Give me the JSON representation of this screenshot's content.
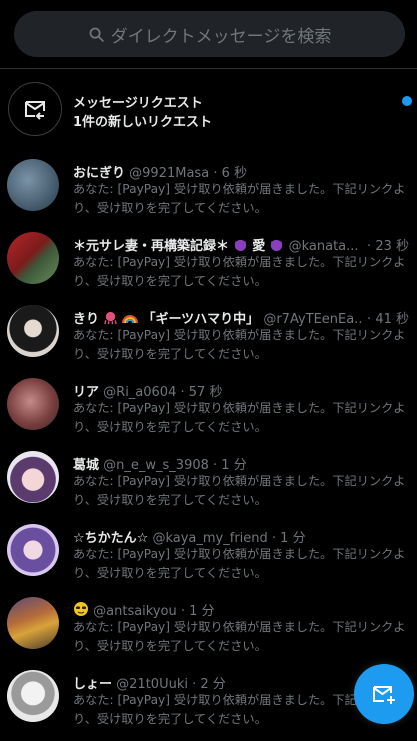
{
  "search": {
    "placeholder": "ダイレクトメッセージを検索"
  },
  "request": {
    "title": "メッセージリクエスト",
    "subtitle": "1件の新しいリクエスト"
  },
  "conversations": [
    {
      "name": "おにぎり",
      "handle": "@9921Masa",
      "time": "6 秒",
      "preview": "あなた: [PayPay] 受け取り依頼が届きました。下記リンクより、受け取りを完了してください。"
    },
    {
      "name": "＊元サレ妻・再構築記録＊",
      "handle": "@kanata...",
      "time": "23 秒",
      "preview": "あなた: [PayPay] 受け取り依頼が届きました。下記リンクより、受け取りを完了してください。"
    },
    {
      "name": "きり",
      "name2": "「ギーツハマり中」",
      "handle": "@r7AyTEenEa...",
      "time": "41 秒",
      "preview": "あなた: [PayPay] 受け取り依頼が届きました。下記リンクより、受け取りを完了してください。"
    },
    {
      "name": "リア",
      "handle": "@Ri_a0604",
      "time": "57 秒",
      "preview": "あなた: [PayPay] 受け取り依頼が届きました。下記リンクより、受け取りを完了してください。"
    },
    {
      "name": "葛城",
      "handle": "@n_e_w_s_3908",
      "time": "1 分",
      "preview": "あなた: [PayPay] 受け取り依頼が届きました。下記リンクより、受け取りを完了してください。"
    },
    {
      "name": "☆ちかたん☆",
      "handle": "@kaya_my_friend",
      "time": "1 分",
      "preview": "あなた: [PayPay] 受け取り依頼が届きました。下記リンクより、受け取りを完了してください。"
    },
    {
      "name": "",
      "handle": "@antsaikyou",
      "time": "1 分",
      "preview": "あなた: [PayPay] 受け取り依頼が届きました。下記リンクより、受け取りを完了してください。"
    },
    {
      "name": "しょー",
      "handle": "@21t0Uuki",
      "time": "2 分",
      "preview": "あなた: [PayPay] 受け取り依頼が届きました。下記リンクより、受け取りを完了してください。"
    }
  ],
  "colors": {
    "accent": "#1d9bf0",
    "background": "#000000",
    "muted": "#71767b",
    "text": "#e7e9ea"
  },
  "icons": {
    "search": "search-icon",
    "request": "message-request-icon",
    "compose": "new-message-icon"
  }
}
